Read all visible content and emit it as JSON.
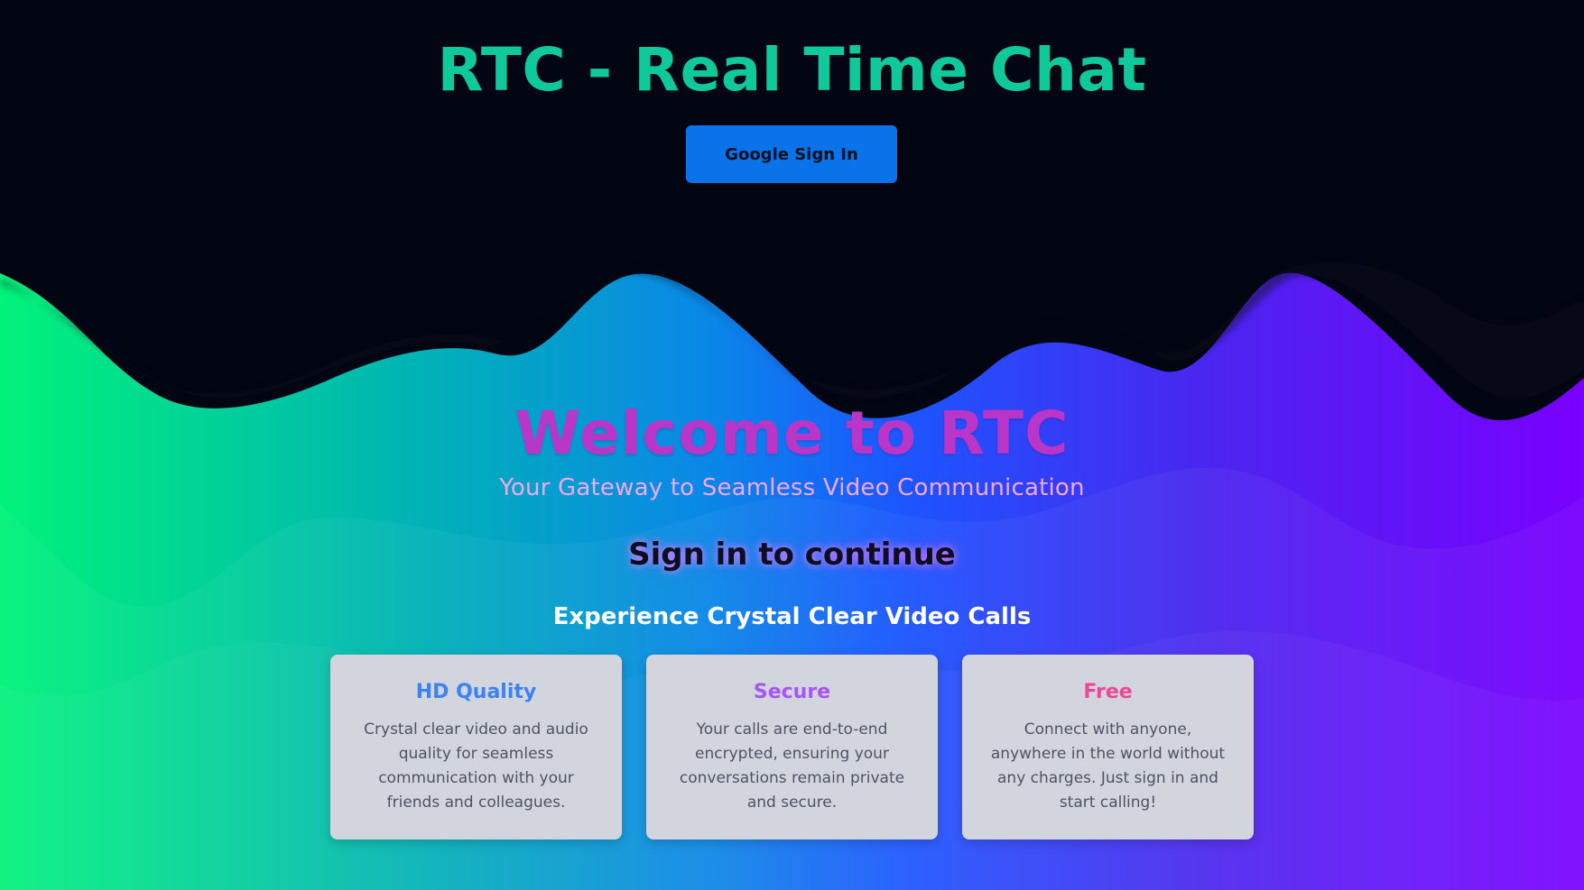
{
  "header": {
    "title": "RTC - Real Time Chat",
    "sign_in_button": "Google Sign In"
  },
  "hero": {
    "welcome": "Welcome to RTC",
    "tagline": "Your Gateway to Seamless Video Communication",
    "sign_in_prompt": "Sign in to continue"
  },
  "features": {
    "title": "Experience Crystal Clear Video Calls",
    "cards": [
      {
        "title": "HD Quality",
        "description": "Crystal clear video and audio quality for seamless communication with your friends and colleagues.",
        "color": "#3b82f6"
      },
      {
        "title": "Secure",
        "description": "Your calls are end-to-end encrypted, ensuring your conversations remain private and secure.",
        "color": "#a855f7"
      },
      {
        "title": "Free",
        "description": "Connect with anyone, anywhere in the world without any charges. Just sign in and start calling!",
        "color": "#ec4899"
      }
    ]
  },
  "colors": {
    "title": "#10c99a",
    "button_bg": "#0a73ea",
    "welcome": "#ba36c9",
    "tagline": "#f2a8ee",
    "gradient_start": "#00f37a",
    "gradient_mid": "#1c56ff",
    "gradient_end": "#7a00ff",
    "top_band": "#030414"
  }
}
